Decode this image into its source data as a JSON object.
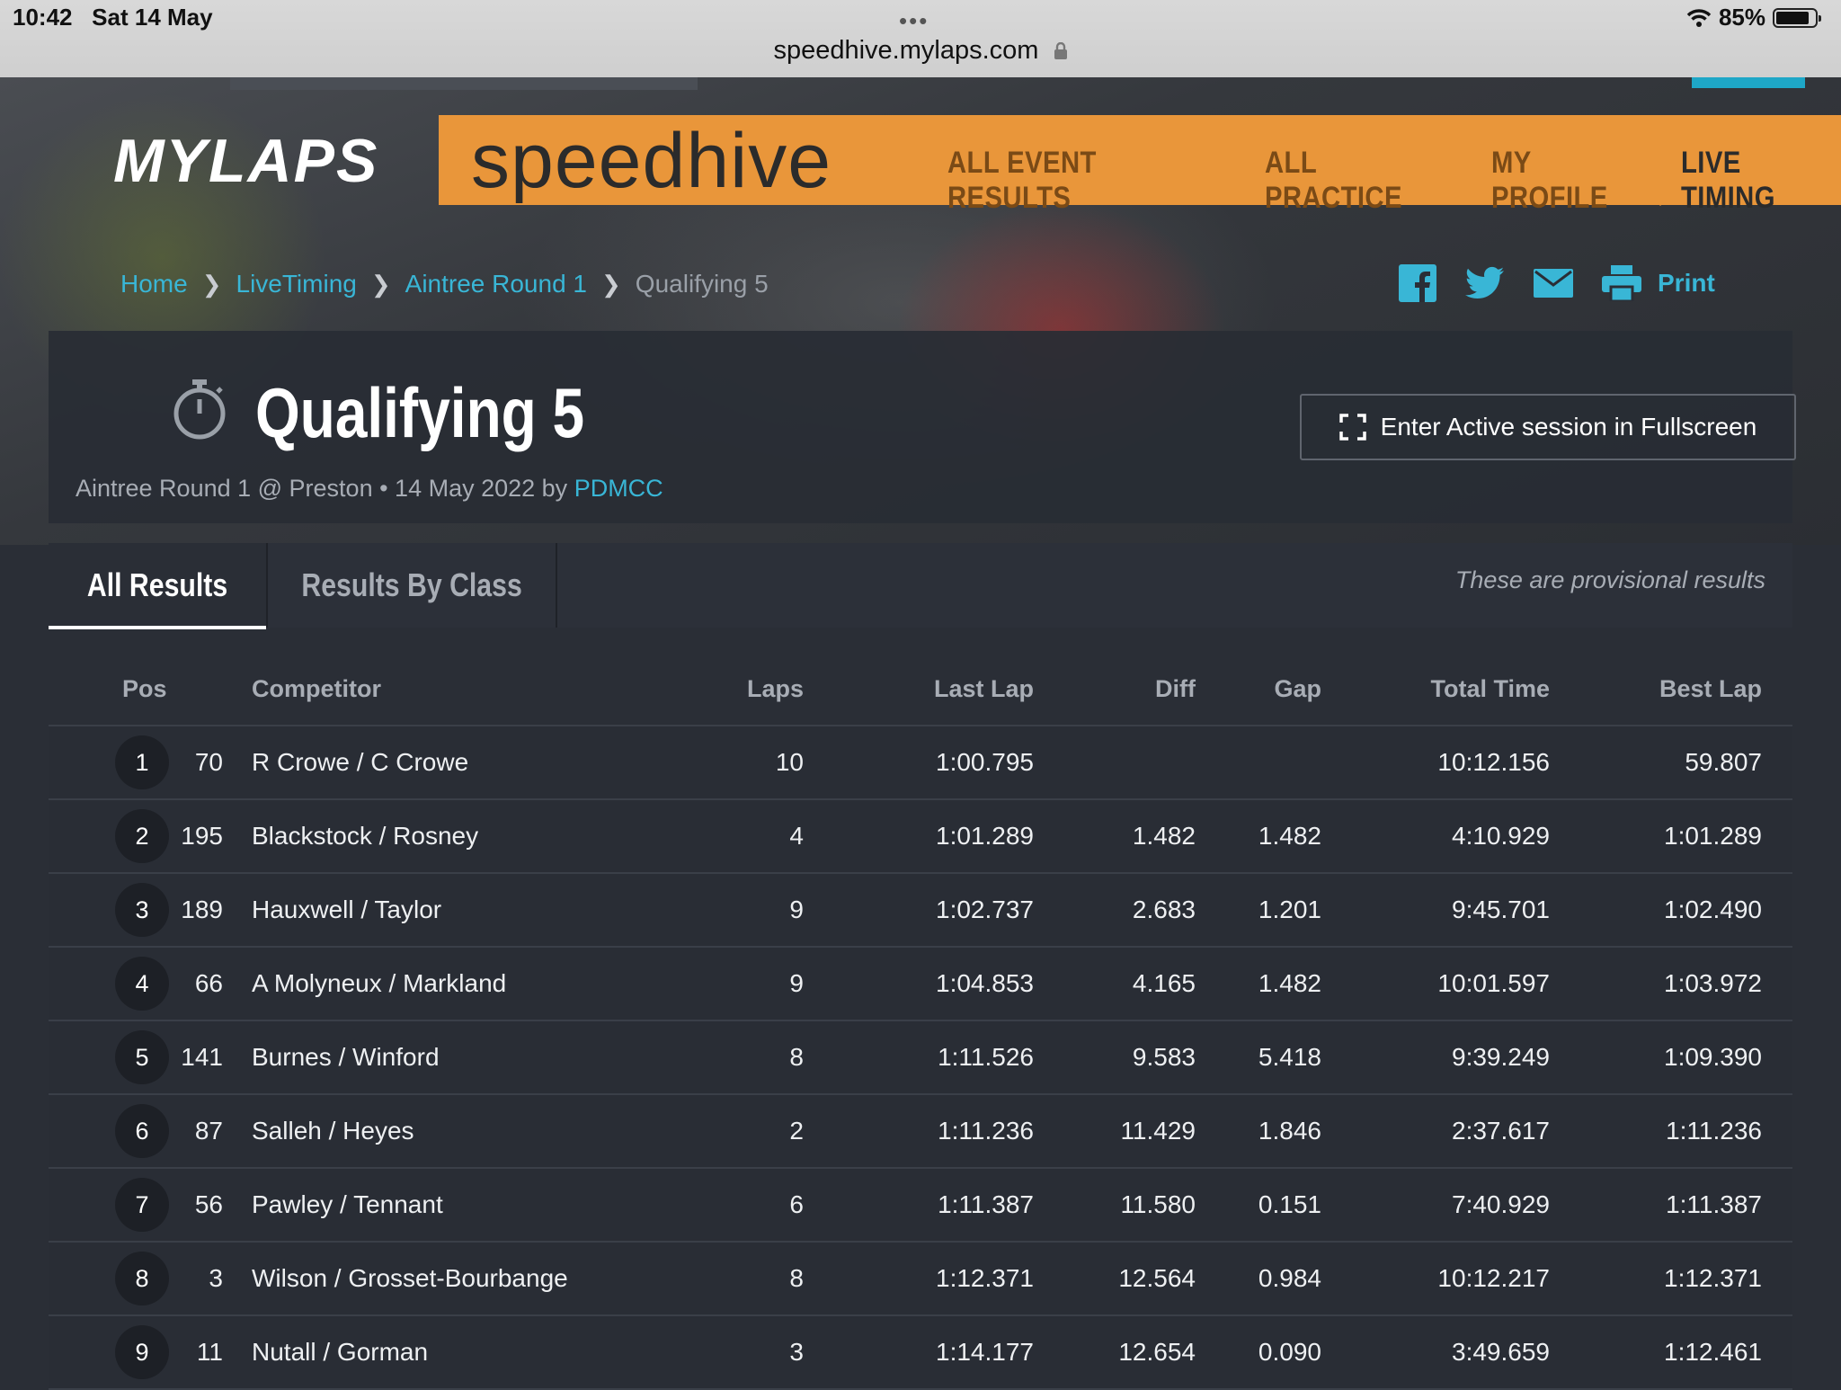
{
  "status": {
    "time": "10:42",
    "date": "Sat 14 May",
    "battery": "85%",
    "battery_level": 0.85
  },
  "browser": {
    "url": "speedhive.mylaps.com"
  },
  "logo": "MYLAPS",
  "brand": "speedhive",
  "nav": [
    "ALL EVENT RESULTS",
    "ALL PRACTICE",
    "MY PROFILE",
    "LIVE TIMING"
  ],
  "nav_active": "LIVE TIMING",
  "breadcrumb": [
    "Home",
    "LiveTiming",
    "Aintree Round 1",
    "Qualifying 5"
  ],
  "share": {
    "print": "Print",
    "icons": [
      "facebook-icon",
      "twitter-icon",
      "mail-icon",
      "printer-icon"
    ]
  },
  "session": {
    "title": "Qualifying 5",
    "subtitle": "Aintree Round 1 @ Preston • 14 May 2022 by",
    "organizer": "PDMCC",
    "fullscreen_button": "Enter Active session in Fullscreen"
  },
  "tabs": [
    "All Results",
    "Results By Class"
  ],
  "provisional_note": "These are provisional results",
  "columns": [
    "Pos",
    "Competitor",
    "Laps",
    "Last Lap",
    "Diff",
    "Gap",
    "Total Time",
    "Best Lap"
  ],
  "rows": [
    {
      "pos": "1",
      "num": "70",
      "name": "R Crowe / C Crowe",
      "laps": "10",
      "last": "1:00.795",
      "diff": "",
      "gap": "",
      "total": "10:12.156",
      "best": "59.807"
    },
    {
      "pos": "2",
      "num": "195",
      "name": "Blackstock / Rosney",
      "laps": "4",
      "last": "1:01.289",
      "diff": "1.482",
      "gap": "1.482",
      "total": "4:10.929",
      "best": "1:01.289"
    },
    {
      "pos": "3",
      "num": "189",
      "name": "Hauxwell / Taylor",
      "laps": "9",
      "last": "1:02.737",
      "diff": "2.683",
      "gap": "1.201",
      "total": "9:45.701",
      "best": "1:02.490"
    },
    {
      "pos": "4",
      "num": "66",
      "name": "A Molyneux / Markland",
      "laps": "9",
      "last": "1:04.853",
      "diff": "4.165",
      "gap": "1.482",
      "total": "10:01.597",
      "best": "1:03.972"
    },
    {
      "pos": "5",
      "num": "141",
      "name": "Burnes / Winford",
      "laps": "8",
      "last": "1:11.526",
      "diff": "9.583",
      "gap": "5.418",
      "total": "9:39.249",
      "best": "1:09.390"
    },
    {
      "pos": "6",
      "num": "87",
      "name": "Salleh / Heyes",
      "laps": "2",
      "last": "1:11.236",
      "diff": "11.429",
      "gap": "1.846",
      "total": "2:37.617",
      "best": "1:11.236"
    },
    {
      "pos": "7",
      "num": "56",
      "name": "Pawley / Tennant",
      "laps": "6",
      "last": "1:11.387",
      "diff": "11.580",
      "gap": "0.151",
      "total": "7:40.929",
      "best": "1:11.387"
    },
    {
      "pos": "8",
      "num": "3",
      "name": "Wilson / Grosset-Bourbange",
      "laps": "8",
      "last": "1:12.371",
      "diff": "12.564",
      "gap": "0.984",
      "total": "10:12.217",
      "best": "1:12.371"
    },
    {
      "pos": "9",
      "num": "11",
      "name": "Nutall / Gorman",
      "laps": "3",
      "last": "1:14.177",
      "diff": "12.654",
      "gap": "0.090",
      "total": "3:49.659",
      "best": "1:12.461"
    }
  ],
  "colors": {
    "accent": "#e9963a",
    "link": "#39b6d6",
    "panel": "#292d35"
  }
}
